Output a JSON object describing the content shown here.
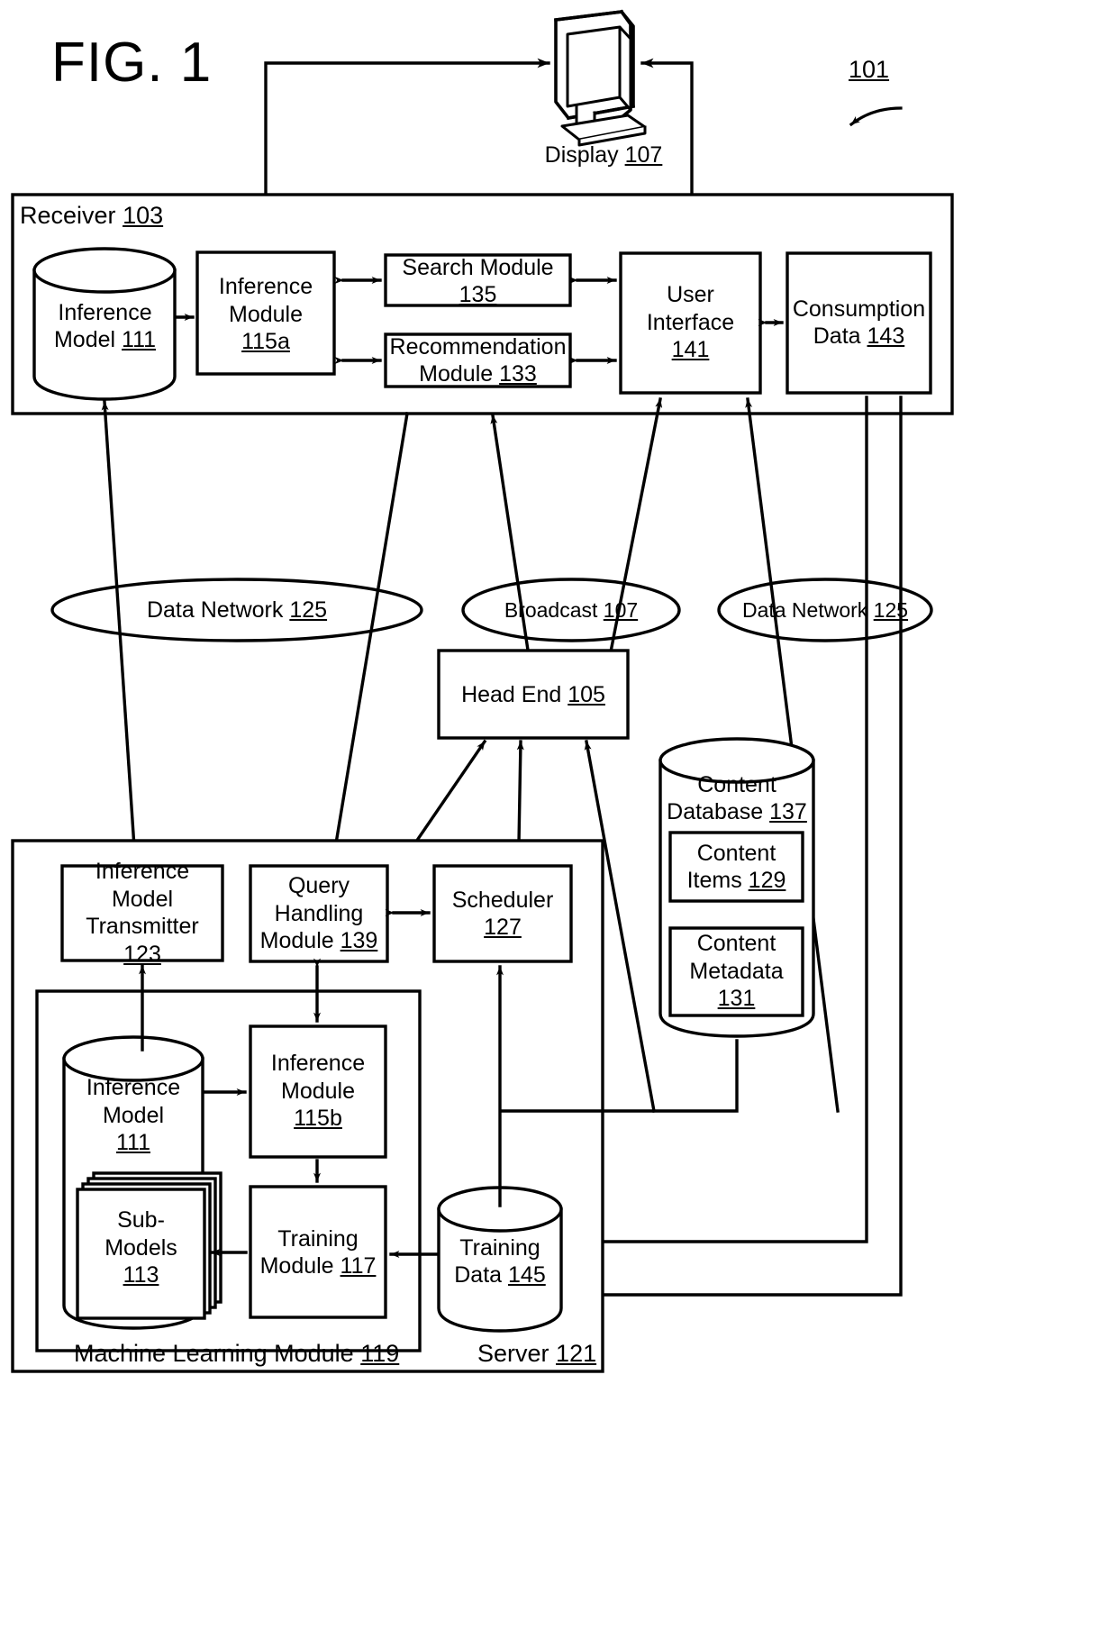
{
  "figure": {
    "title": "FIG. 1",
    "system_ref": "101"
  },
  "display": {
    "label": "Display",
    "ref": "107",
    "icon": "monitor-icon"
  },
  "receiver": {
    "label": "Receiver",
    "ref": "103",
    "blocks": [
      {
        "name": "inference-model-store",
        "lines": [
          "Inference",
          "Model"
        ],
        "ref": "111",
        "shape": "cylinder"
      },
      {
        "name": "inference-module",
        "lines": [
          "Inference",
          "Module"
        ],
        "ref": "115a",
        "shape": "rect"
      },
      {
        "name": "search-module",
        "lines": [
          "Search Module"
        ],
        "ref": "135",
        "shape": "rect"
      },
      {
        "name": "recommendation-module",
        "lines": [
          "Recommendation",
          "Module"
        ],
        "ref": "133",
        "shape": "rect"
      },
      {
        "name": "user-interface",
        "lines": [
          "User",
          "Interface"
        ],
        "ref": "141",
        "shape": "rect"
      },
      {
        "name": "consumption-data",
        "lines": [
          "Consumption",
          "Data"
        ],
        "ref": "143",
        "shape": "rect"
      }
    ]
  },
  "networks": [
    {
      "name": "data-network-left",
      "label": "Data Network",
      "ref": "125"
    },
    {
      "name": "broadcast-network",
      "label": "Broadcast",
      "ref": "107"
    },
    {
      "name": "data-network-right",
      "label": "Data Network",
      "ref": "125"
    }
  ],
  "head_end": {
    "label": "Head End",
    "ref": "105"
  },
  "content_database": {
    "label": "Content Database",
    "lines": [
      "Content",
      "Database"
    ],
    "ref": "137",
    "items": [
      {
        "name": "content-items",
        "lines": [
          "Content",
          "Items"
        ],
        "ref": "129"
      },
      {
        "name": "content-metadata",
        "lines": [
          "Content",
          "Metadata"
        ],
        "ref": "131"
      }
    ]
  },
  "server": {
    "label": "Server",
    "ref": "121",
    "blocks": [
      {
        "name": "inference-model-transmitter",
        "lines": [
          "Inference",
          "Model",
          "Transmitter"
        ],
        "ref": "123"
      },
      {
        "name": "query-handling-module",
        "lines": [
          "Query",
          "Handling",
          "Module"
        ],
        "ref": "139"
      },
      {
        "name": "scheduler",
        "lines": [
          "Scheduler"
        ],
        "ref": "127"
      }
    ],
    "training_data": {
      "name": "training-data",
      "lines": [
        "Training",
        "Data"
      ],
      "ref": "145"
    },
    "machine_learning_module": {
      "label": "Machine Learning Module",
      "ref": "119",
      "blocks": [
        {
          "name": "inference-model-store-server",
          "lines": [
            "Inference",
            "Model"
          ],
          "ref": "111",
          "shape": "cylinder"
        },
        {
          "name": "sub-models",
          "lines": [
            "Sub-",
            "Models"
          ],
          "ref": "113",
          "shape": "stack"
        },
        {
          "name": "inference-module-server",
          "lines": [
            "Inference",
            "Module"
          ],
          "ref": "115b",
          "shape": "rect"
        },
        {
          "name": "training-module",
          "lines": [
            "Training",
            "Module"
          ],
          "ref": "117",
          "shape": "rect"
        }
      ]
    }
  },
  "colors": {
    "stroke": "#000000",
    "background": "#ffffff"
  }
}
